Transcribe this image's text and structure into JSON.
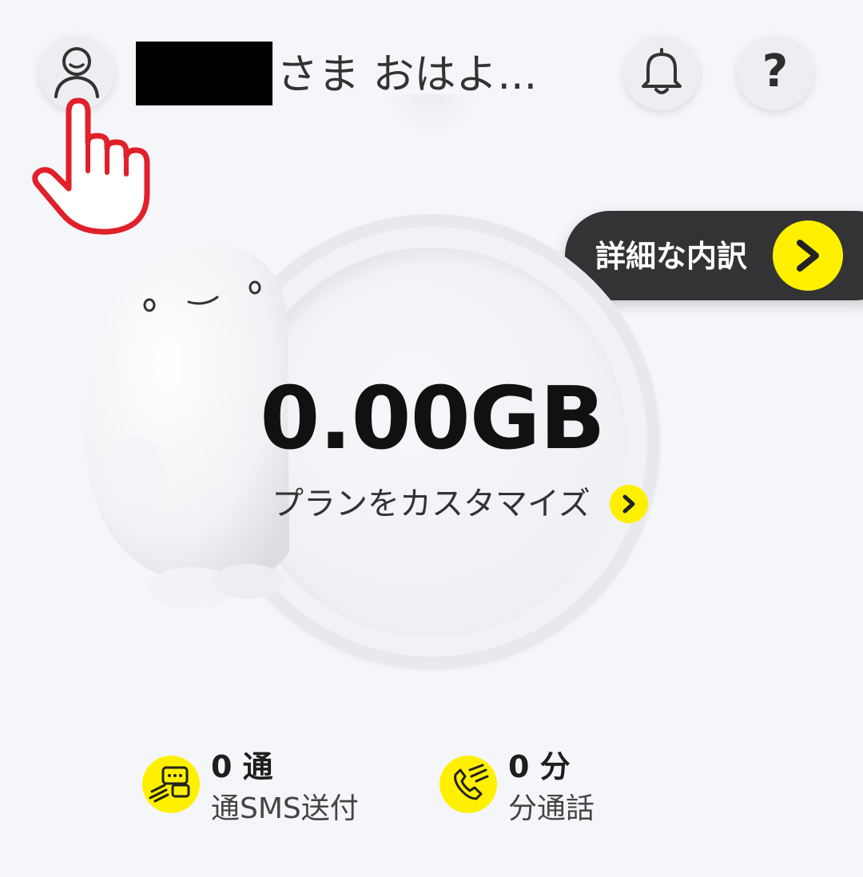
{
  "header": {
    "greeting": "さま おはよ...",
    "help_label": "?",
    "icons": {
      "profile": "person-outline-icon",
      "notifications": "bell-icon",
      "help": "question-mark-icon",
      "tap_hint": "pointing-hand-icon"
    }
  },
  "details_button": {
    "label": "詳細な内訳",
    "icon": "chevron-right-icon"
  },
  "data_usage": {
    "amount": "0.00GB",
    "plan_link_label": "プランをカスタマイズ",
    "plan_link_icon": "chevron-right-icon"
  },
  "stats": {
    "sms": {
      "value": "0 通",
      "label": "通SMS送付",
      "icon": "chat-bubbles-icon"
    },
    "calls": {
      "value": "0 分",
      "label": "分通話",
      "icon": "phone-icon"
    }
  },
  "colors": {
    "background": "#f5f6fa",
    "accent_yellow": "#fff000",
    "pill_dark": "#333335",
    "hand_red": "#e0202a"
  }
}
